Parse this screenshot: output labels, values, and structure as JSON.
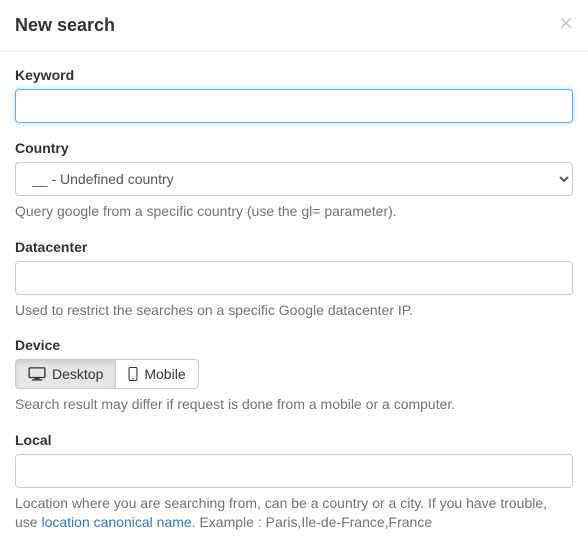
{
  "header": {
    "title": "New search"
  },
  "form": {
    "keyword": {
      "label": "Keyword",
      "value": ""
    },
    "country": {
      "label": "Country",
      "selected": "__ - Undefined country",
      "help": "Query google from a specific country (use the gl= parameter)."
    },
    "datacenter": {
      "label": "Datacenter",
      "value": "",
      "help": "Used to restrict the searches on a specific Google datacenter IP."
    },
    "device": {
      "label": "Device",
      "options": {
        "desktop": "Desktop",
        "mobile": "Mobile"
      },
      "help": "Search result may differ if request is done from a mobile or a computer."
    },
    "local": {
      "label": "Local",
      "value": "",
      "help_prefix": "Location where you are searching from, can be a country or a city. If you have trouble, use ",
      "help_link_text": "location canonical name",
      "help_suffix": ". Example : Paris,Ile-de-France,France"
    }
  }
}
